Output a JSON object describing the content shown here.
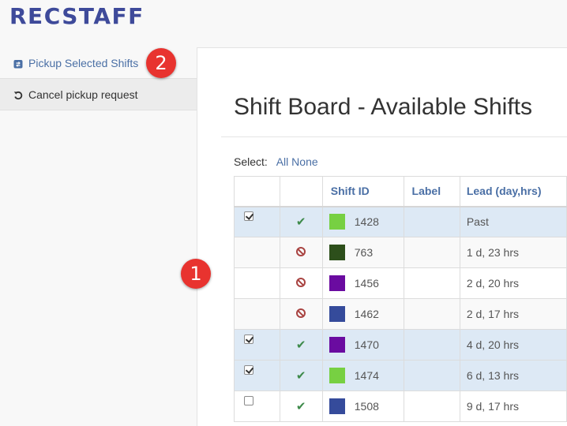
{
  "app": {
    "logo": "RECSTAFF"
  },
  "sidebar": {
    "items": [
      {
        "label": "Pickup Selected Shifts",
        "icon": "calendar-swap-icon"
      },
      {
        "label": "Cancel pickup request",
        "icon": "undo-icon"
      }
    ]
  },
  "annotations": {
    "badge_1": "1",
    "badge_2": "2",
    "badge_color": "#e8332f"
  },
  "main": {
    "title": "Shift Board - Available Shifts",
    "select_label": "Select:",
    "select_all": "All",
    "select_none": "None"
  },
  "table": {
    "headers": {
      "shift_id": "Shift ID",
      "label": "Label",
      "lead": "Lead (day,hrs)"
    },
    "rows": [
      {
        "checked": true,
        "status": "ok",
        "color": "#77d042",
        "id": "1428",
        "label": "",
        "lead": "Past"
      },
      {
        "checked": null,
        "status": "blocked",
        "color": "#2d4f1b",
        "id": "763",
        "label": "",
        "lead": "1 d, 23 hrs"
      },
      {
        "checked": null,
        "status": "blocked",
        "color": "#6a0ba0",
        "id": "1456",
        "label": "",
        "lead": "2 d, 20 hrs"
      },
      {
        "checked": null,
        "status": "blocked",
        "color": "#354b9b",
        "id": "1462",
        "label": "",
        "lead": "2 d, 17 hrs"
      },
      {
        "checked": true,
        "status": "ok",
        "color": "#6a0ba0",
        "id": "1470",
        "label": "",
        "lead": "4 d, 20 hrs"
      },
      {
        "checked": true,
        "status": "ok",
        "color": "#77d042",
        "id": "1474",
        "label": "",
        "lead": "6 d, 13 hrs"
      },
      {
        "checked": false,
        "status": "ok",
        "color": "#354b9b",
        "id": "1508",
        "label": "",
        "lead": "9 d, 17 hrs"
      }
    ]
  },
  "colors": {
    "accent": "#3e4a9a",
    "link": "#4a6fa5",
    "selected_row": "#dde9f5",
    "ok": "#3d8a4a",
    "blocked": "#a94442"
  }
}
